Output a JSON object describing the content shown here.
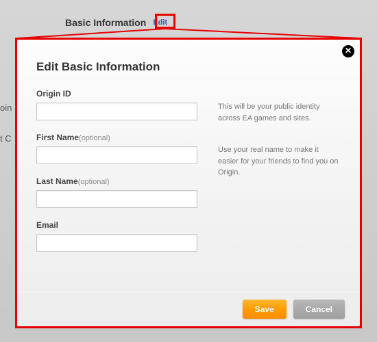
{
  "background": {
    "section_title": "Basic Information",
    "edit_link": "Edit",
    "side_items": [
      "oin",
      "t C"
    ]
  },
  "modal": {
    "title": "Edit Basic Information",
    "close_symbol": "✕",
    "fields": {
      "origin_id": {
        "label": "Origin ID",
        "value": ""
      },
      "first_name": {
        "label": "First Name",
        "optional": "(optional)",
        "value": ""
      },
      "last_name": {
        "label": "Last Name",
        "optional": "(optional)",
        "value": ""
      },
      "email": {
        "label": "Email",
        "value": ""
      }
    },
    "hints": {
      "origin": "This will be your public identity across EA games and sites.",
      "name": "Use your real name to make it easier for your friends to find you on Origin."
    },
    "buttons": {
      "save": "Save",
      "cancel": "Cancel"
    }
  }
}
